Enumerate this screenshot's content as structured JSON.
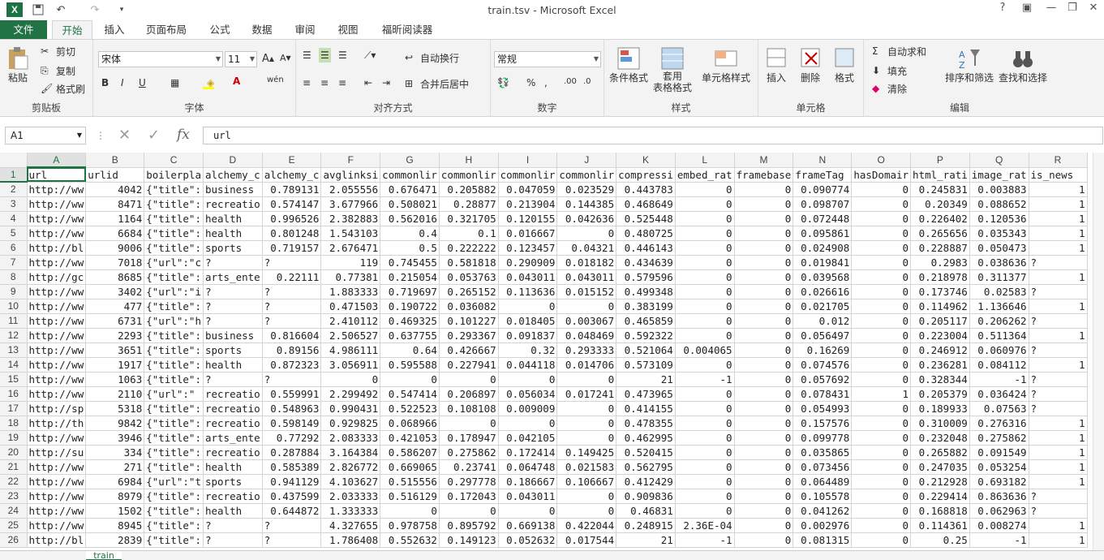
{
  "window": {
    "title": "train.tsv - Microsoft Excel"
  },
  "tabs": [
    "文件",
    "开始",
    "插入",
    "页面布局",
    "公式",
    "数据",
    "审阅",
    "视图",
    "福昕阅读器"
  ],
  "ribbon": {
    "clipboard": {
      "paste": "粘贴",
      "cut": "剪切",
      "copy": "复制",
      "format_painter": "格式刷",
      "label": "剪贴板"
    },
    "font": {
      "name": "宋体",
      "size": "11",
      "label": "字体"
    },
    "alignment": {
      "wrap": "自动换行",
      "merge": "合并后居中",
      "label": "对齐方式"
    },
    "number": {
      "format": "常规",
      "label": "数字"
    },
    "styles": {
      "conditional": "条件格式",
      "table_line1": "套用",
      "table_line2": "表格格式",
      "cell_styles": "单元格样式",
      "label": "样式"
    },
    "cells": {
      "insert": "插入",
      "delete": "删除",
      "format": "格式",
      "label": "单元格"
    },
    "editing": {
      "autosum": "自动求和",
      "fill": "填充",
      "clear": "清除",
      "sort": "排序和筛选",
      "find": "查找和选择",
      "label": "编辑"
    }
  },
  "formula_bar": {
    "name_box": "A1",
    "content": "url"
  },
  "columns": [
    "A",
    "B",
    "C",
    "D",
    "E",
    "F",
    "G",
    "H",
    "I",
    "J",
    "K",
    "L",
    "M",
    "N",
    "O",
    "P",
    "Q",
    "R"
  ],
  "headers": [
    "url",
    "urlid",
    "boilerpla",
    "alchemy_c",
    "alchemy_c",
    "avglinksi",
    "commonlir",
    "commonlir",
    "commonlir",
    "commonlir",
    "compressi",
    "embed_rat",
    "framebase",
    "frameTag",
    "hasDomair",
    "html_rati",
    "image_rat",
    "is_news"
  ],
  "rows": [
    [
      "http://ww",
      "4042",
      "{\"title\":",
      "business",
      "0.789131",
      "2.055556",
      "0.676471",
      "0.205882",
      "0.047059",
      "0.023529",
      "0.443783",
      "0",
      "0",
      "0.090774",
      "0",
      "0.245831",
      "0.003883",
      "1"
    ],
    [
      "http://ww",
      "8471",
      "{\"title\":",
      "recreatio",
      "0.574147",
      "3.677966",
      "0.508021",
      "0.28877",
      "0.213904",
      "0.144385",
      "0.468649",
      "0",
      "0",
      "0.098707",
      "0",
      "0.20349",
      "0.088652",
      "1"
    ],
    [
      "http://ww",
      "1164",
      "{\"title\":",
      "health",
      "0.996526",
      "2.382883",
      "0.562016",
      "0.321705",
      "0.120155",
      "0.042636",
      "0.525448",
      "0",
      "0",
      "0.072448",
      "0",
      "0.226402",
      "0.120536",
      "1"
    ],
    [
      "http://ww",
      "6684",
      "{\"title\":",
      "health",
      "0.801248",
      "1.543103",
      "0.4",
      "0.1",
      "0.016667",
      "0",
      "0.480725",
      "0",
      "0",
      "0.095861",
      "0",
      "0.265656",
      "0.035343",
      "1"
    ],
    [
      "http://bl",
      "9006",
      "{\"title\":",
      "sports",
      "0.719157",
      "2.676471",
      "0.5",
      "0.222222",
      "0.123457",
      "0.04321",
      "0.446143",
      "0",
      "0",
      "0.024908",
      "0",
      "0.228887",
      "0.050473",
      "1"
    ],
    [
      "http://ww",
      "7018",
      "{\"url\":\"c",
      "?",
      "?",
      "119",
      "0.745455",
      "0.581818",
      "0.290909",
      "0.018182",
      "0.434639",
      "0",
      "0",
      "0.019841",
      "0",
      "0.2983",
      "0.038636",
      "?"
    ],
    [
      "http://gc",
      "8685",
      "{\"title\":",
      "arts_ente",
      "0.22111",
      "0.77381",
      "0.215054",
      "0.053763",
      "0.043011",
      "0.043011",
      "0.579596",
      "0",
      "0",
      "0.039568",
      "0",
      "0.218978",
      "0.311377",
      "1"
    ],
    [
      "http://ww",
      "3402",
      "{\"url\":\"i",
      "?",
      "?",
      "1.883333",
      "0.719697",
      "0.265152",
      "0.113636",
      "0.015152",
      "0.499348",
      "0",
      "0",
      "0.026616",
      "0",
      "0.173746",
      "0.02583",
      "?"
    ],
    [
      "http://ww",
      "477",
      "{\"title\":",
      "?",
      "?",
      "0.471503",
      "0.190722",
      "0.036082",
      "0",
      "0",
      "0.383199",
      "0",
      "0",
      "0.021705",
      "0",
      "0.114962",
      "1.136646",
      "1"
    ],
    [
      "http://ww",
      "6731",
      "{\"url\":\"h",
      "?",
      "?",
      "2.410112",
      "0.469325",
      "0.101227",
      "0.018405",
      "0.003067",
      "0.465859",
      "0",
      "0",
      "0.012",
      "0",
      "0.205117",
      "0.206262",
      "?"
    ],
    [
      "http://ww",
      "2293",
      "{\"title\":",
      "business",
      "0.816604",
      "2.506527",
      "0.637755",
      "0.293367",
      "0.091837",
      "0.048469",
      "0.592322",
      "0",
      "0",
      "0.056497",
      "0",
      "0.223004",
      "0.511364",
      "1"
    ],
    [
      "http://ww",
      "3651",
      "{\"title\":",
      "sports",
      "0.89156",
      "4.986111",
      "0.64",
      "0.426667",
      "0.32",
      "0.293333",
      "0.521064",
      "0.004065",
      "0",
      "0.16269",
      "0",
      "0.246912",
      "0.060976",
      "?"
    ],
    [
      "http://ww",
      "1917",
      "{\"title\":",
      "health",
      "0.872323",
      "3.056911",
      "0.595588",
      "0.227941",
      "0.044118",
      "0.014706",
      "0.573109",
      "0",
      "0",
      "0.074576",
      "0",
      "0.236281",
      "0.084112",
      "1"
    ],
    [
      "http://ww",
      "1063",
      "{\"title\":",
      "?",
      "?",
      "0",
      "0",
      "0",
      "0",
      "0",
      "21",
      "-1",
      "0",
      "0.057692",
      "0",
      "0.328344",
      "-1",
      "?"
    ],
    [
      "http://ww",
      "2110",
      "{\"url\":\"",
      "recreatio",
      "0.559991",
      "2.299492",
      "0.547414",
      "0.206897",
      "0.056034",
      "0.017241",
      "0.473965",
      "0",
      "0",
      "0.078431",
      "1",
      "0.205379",
      "0.036424",
      "?"
    ],
    [
      "http://sp",
      "5318",
      "{\"title\":",
      "recreatio",
      "0.548963",
      "0.990431",
      "0.522523",
      "0.108108",
      "0.009009",
      "0",
      "0.414155",
      "0",
      "0",
      "0.054993",
      "0",
      "0.189933",
      "0.07563",
      "?"
    ],
    [
      "http://th",
      "9842",
      "{\"title\":",
      "recreatio",
      "0.598149",
      "0.929825",
      "0.068966",
      "0",
      "0",
      "0",
      "0.478355",
      "0",
      "0",
      "0.157576",
      "0",
      "0.310009",
      "0.276316",
      "1"
    ],
    [
      "http://ww",
      "3946",
      "{\"title\":",
      "arts_ente",
      "0.77292",
      "2.083333",
      "0.421053",
      "0.178947",
      "0.042105",
      "0",
      "0.462995",
      "0",
      "0",
      "0.099778",
      "0",
      "0.232048",
      "0.275862",
      "1"
    ],
    [
      "http://su",
      "334",
      "{\"title\":",
      "recreatio",
      "0.287884",
      "3.164384",
      "0.586207",
      "0.275862",
      "0.172414",
      "0.149425",
      "0.520415",
      "0",
      "0",
      "0.035865",
      "0",
      "0.265882",
      "0.091549",
      "1"
    ],
    [
      "http://ww",
      "271",
      "{\"title\":",
      "health",
      "0.585389",
      "2.826772",
      "0.669065",
      "0.23741",
      "0.064748",
      "0.021583",
      "0.562795",
      "0",
      "0",
      "0.073456",
      "0",
      "0.247035",
      "0.053254",
      "1"
    ],
    [
      "http://ww",
      "6984",
      "{\"url\":\"t",
      "sports",
      "0.941129",
      "4.103627",
      "0.515556",
      "0.297778",
      "0.186667",
      "0.106667",
      "0.412429",
      "0",
      "0",
      "0.064489",
      "0",
      "0.212928",
      "0.693182",
      "1"
    ],
    [
      "http://ww",
      "8979",
      "{\"title\":",
      "recreatio",
      "0.437599",
      "2.033333",
      "0.516129",
      "0.172043",
      "0.043011",
      "0",
      "0.909836",
      "0",
      "0",
      "0.105578",
      "0",
      "0.229414",
      "0.863636",
      "?"
    ],
    [
      "http://ww",
      "1502",
      "{\"title\":",
      "health",
      "0.644872",
      "1.333333",
      "0",
      "0",
      "0",
      "0",
      "0.46831",
      "0",
      "0",
      "0.041262",
      "0",
      "0.168818",
      "0.062963",
      "?"
    ],
    [
      "http://ww",
      "8945",
      "{\"title\":",
      "?",
      "?",
      "4.327655",
      "0.978758",
      "0.895792",
      "0.669138",
      "0.422044",
      "0.248915",
      "2.36E-04",
      "0",
      "0.002976",
      "0",
      "0.114361",
      "0.008274",
      "1"
    ],
    [
      "http://bl",
      "2839",
      "{\"title\":",
      "?",
      "?",
      "1.786408",
      "0.552632",
      "0.149123",
      "0.052632",
      "0.017544",
      "21",
      "-1",
      "0",
      "0.081315",
      "0",
      "0.25",
      "-1",
      "1"
    ]
  ],
  "sheet": {
    "tab": "train"
  }
}
